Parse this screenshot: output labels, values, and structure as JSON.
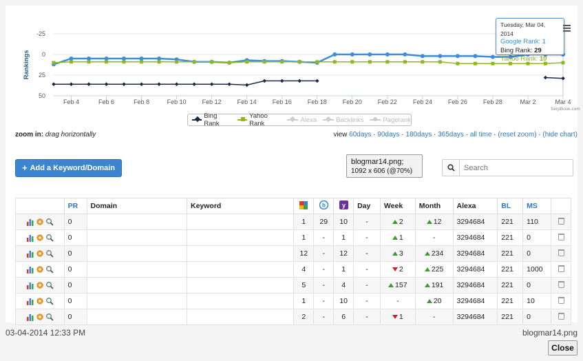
{
  "chart_data": {
    "type": "line",
    "ylabel": "Rankings",
    "y_reversed": true,
    "ylim": [
      -25,
      50
    ],
    "yticks": [
      "-25",
      "0",
      "25",
      "50"
    ],
    "x_tick_labels": [
      "Feb 4",
      "Feb 6",
      "Feb 8",
      "Feb 10",
      "Feb 12",
      "Feb 14",
      "Feb 16",
      "Feb 18",
      "Feb 20",
      "Feb 22",
      "Feb 24",
      "Feb 26",
      "Feb 28",
      "Mar 2",
      "Mar 4"
    ],
    "dates": [
      "Feb 3",
      "Feb 4",
      "Feb 5",
      "Feb 6",
      "Feb 7",
      "Feb 8",
      "Feb 9",
      "Feb 10",
      "Feb 11",
      "Feb 12",
      "Feb 13",
      "Feb 14",
      "Feb 15",
      "Feb 16",
      "Feb 17",
      "Feb 18",
      "Feb 19",
      "Feb 20",
      "Feb 21",
      "Feb 22",
      "Feb 23",
      "Feb 24",
      "Feb 25",
      "Feb 26",
      "Feb 27",
      "Feb 28",
      "Mar 1",
      "Mar 2",
      "Mar 3",
      "Mar 4"
    ],
    "series": [
      {
        "name": "Google Rank",
        "color": "#3c8dd8",
        "values": [
          12,
          5,
          5,
          5,
          5,
          5,
          5,
          6,
          9,
          9,
          10,
          7,
          8,
          8,
          9,
          10,
          0,
          0,
          0,
          0,
          0,
          2,
          2,
          2,
          2,
          3,
          3,
          0,
          0,
          0
        ]
      },
      {
        "name": "Bing Rank",
        "color": "#1a2a45",
        "values": [
          36,
          36,
          36,
          36,
          36,
          36,
          36,
          36,
          36,
          36,
          36,
          37,
          32,
          32,
          32,
          32,
          null,
          null,
          null,
          null,
          null,
          null,
          null,
          null,
          null,
          null,
          null,
          null,
          28,
          29
        ]
      },
      {
        "name": "Yahoo Rank",
        "color": "#8fb81c",
        "values": [
          10,
          9,
          9,
          9,
          9,
          9,
          9,
          9,
          9,
          9,
          10,
          9,
          9,
          9,
          9,
          9,
          9,
          9,
          9,
          9,
          9,
          9,
          9,
          11,
          11,
          11,
          11,
          11,
          11,
          10
        ]
      }
    ],
    "legend": [
      {
        "name": "Bing Rank",
        "active": true
      },
      {
        "name": "Yahoo Rank",
        "active": true
      },
      {
        "name": "Alexa",
        "active": false
      },
      {
        "name": "Backlinks",
        "active": false
      },
      {
        "name": "Pagerank",
        "active": false
      }
    ],
    "tooltip": {
      "date": "Tuesday, Mar 04, 2014",
      "google_label": "Google Rank:",
      "google_value": "1",
      "bing_label": "Bing Rank:",
      "bing_value": "29",
      "yahoo_label": "Yahoo Rank:",
      "yahoo_value": "10"
    },
    "credit": "SerpBook.com"
  },
  "zoom": {
    "label": "zoom in:",
    "hint": "drag horizontally"
  },
  "view": {
    "label": "view",
    "links": [
      "60days",
      "90days",
      "180days",
      "365days",
      "all time",
      "(reset zoom)",
      "(hide chart)"
    ]
  },
  "add_button": {
    "label": "Add a Keyword/Domain"
  },
  "image_info": {
    "name": "blogmar14.png;",
    "dims": "1092 x 606 (@70%)"
  },
  "search": {
    "placeholder": "Search"
  },
  "table": {
    "headers": {
      "pr": "PR",
      "domain": "Domain",
      "keyword": "Keyword",
      "day": "Day",
      "week": "Week",
      "month": "Month",
      "alexa": "Alexa",
      "bl": "BL",
      "ms": "MS"
    },
    "rows": [
      {
        "pr": "0",
        "g": "1",
        "b": "29",
        "y": "10",
        "day": "-",
        "week": "2",
        "week_dir": "up",
        "month": "12",
        "month_dir": "up",
        "alexa": "3294684",
        "bl": "221",
        "ms": "110"
      },
      {
        "pr": "0",
        "g": "1",
        "b": "-",
        "y": "1",
        "day": "-",
        "week": "1",
        "week_dir": "up",
        "month": "-",
        "month_dir": "",
        "alexa": "3294684",
        "bl": "221",
        "ms": "0"
      },
      {
        "pr": "0",
        "g": "12",
        "b": "-",
        "y": "12",
        "day": "-",
        "week": "3",
        "week_dir": "up",
        "month": "234",
        "month_dir": "up",
        "alexa": "3294684",
        "bl": "221",
        "ms": "0"
      },
      {
        "pr": "0",
        "g": "4",
        "b": "-",
        "y": "1",
        "day": "-",
        "week": "2",
        "week_dir": "down",
        "month": "225",
        "month_dir": "up",
        "alexa": "3294684",
        "bl": "221",
        "ms": "1000"
      },
      {
        "pr": "0",
        "g": "5",
        "b": "-",
        "y": "4",
        "day": "-",
        "week": "157",
        "week_dir": "up",
        "month": "191",
        "month_dir": "up",
        "alexa": "3294684",
        "bl": "221",
        "ms": "0"
      },
      {
        "pr": "0",
        "g": "1",
        "b": "-",
        "y": "10",
        "day": "-",
        "week": "-",
        "week_dir": "",
        "month": "20",
        "month_dir": "up",
        "alexa": "3294684",
        "bl": "221",
        "ms": "10"
      },
      {
        "pr": "0",
        "g": "2",
        "b": "-",
        "y": "6",
        "day": "-",
        "week": "1",
        "week_dir": "down",
        "month": "-",
        "month_dir": "",
        "alexa": "3294684",
        "bl": "221",
        "ms": "0"
      }
    ]
  },
  "footer": {
    "date": "03-04-2014 12:33 PM",
    "filename": "blogmar14.png",
    "close_label": "Close"
  }
}
